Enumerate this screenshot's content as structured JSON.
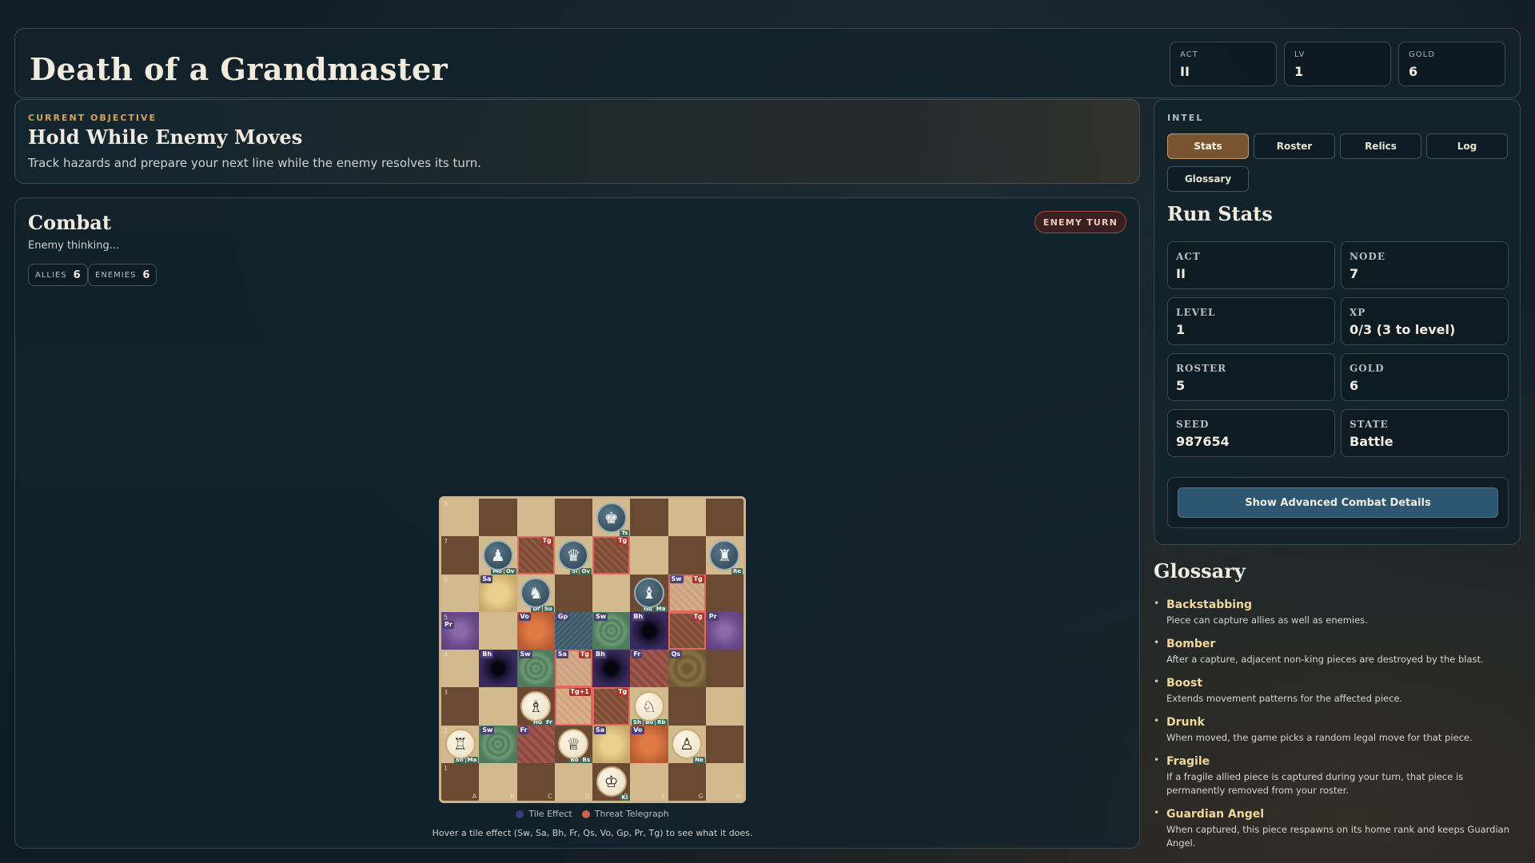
{
  "header": {
    "title": "Death of a Grandmaster",
    "stats": [
      {
        "label": "ACT",
        "value": "II"
      },
      {
        "label": "LV",
        "value": "1"
      },
      {
        "label": "GOLD",
        "value": "6"
      }
    ]
  },
  "objective": {
    "kicker": "CURRENT OBJECTIVE",
    "title": "Hold While Enemy Moves",
    "description": "Track hazards and prepare your next line while the enemy resolves its turn."
  },
  "combat": {
    "title": "Combat",
    "status": "Enemy thinking...",
    "badge": "ENEMY TURN",
    "allies_label": "ALLIES",
    "allies_count": "6",
    "enemies_label": "ENEMIES",
    "enemies_count": "6",
    "legend_tile": "Tile Effect",
    "legend_threat": "Threat Telegraph",
    "legend_tile_color": "#3b3b78",
    "legend_threat_color": "#c8614f",
    "hint": "Hover a tile effect (Sw, Sa, Bh, Fr, Qs, Vo, Gp, Pr, Tg) to see what it does.",
    "files": [
      "A",
      "B",
      "C",
      "D",
      "E",
      "F",
      "G",
      "H"
    ],
    "ranks": [
      "8",
      "7",
      "6",
      "5",
      "4",
      "3",
      "2",
      "1"
    ]
  },
  "board": {
    "a8": {
      "tile": null
    },
    "b8": {},
    "c8": {},
    "d8": {},
    "e8": {
      "piece": "king",
      "side": "enemy",
      "mods": [
        "Ts"
      ]
    },
    "b7": {
      "piece": "pawn",
      "side": "enemy",
      "mods": [
        "Mo",
        "Ov"
      ]
    },
    "c7": {
      "threat": "Tg"
    },
    "d7": {
      "piece": "queen",
      "side": "enemy",
      "mods": [
        "Sl",
        "Ov"
      ]
    },
    "e7": {
      "threat": "Tg"
    },
    "h7": {
      "piece": "rook",
      "side": "enemy",
      "mods": [
        "Re"
      ]
    },
    "b6": {
      "tile": "Sa"
    },
    "c6": {
      "piece": "knight",
      "side": "enemy",
      "mods": [
        "Dr",
        "Su"
      ]
    },
    "f6": {
      "piece": "bishop",
      "side": "enemy",
      "mods": [
        "Gu",
        "Ma"
      ]
    },
    "g6": {
      "tile": "Sw",
      "threat": "Tg"
    },
    "a5": {
      "tile": "Pr"
    },
    "c5": {
      "tile": "Vo"
    },
    "d5": {
      "tile": "Gp"
    },
    "e5": {
      "tile": "Sw"
    },
    "f5": {
      "tile": "Bh"
    },
    "g5": {
      "threat": "Tg"
    },
    "h5": {
      "tile": "Pr"
    },
    "b4": {
      "tile": "Bh"
    },
    "c4": {
      "tile": "Sw"
    },
    "d4": {
      "tile": "Sa",
      "threat": "Tg"
    },
    "e4": {
      "tile": "Bh"
    },
    "f4": {
      "tile": "Fr"
    },
    "g4": {
      "tile": "Qs"
    },
    "c3": {
      "piece": "bishop",
      "side": "ally",
      "mods": [
        "Hu",
        "Fr"
      ]
    },
    "d3": {
      "threat": "Tg+1"
    },
    "e3": {
      "threat": "Tg"
    },
    "f3": {
      "piece": "knight",
      "side": "ally",
      "mods": [
        "Sh",
        "Bo",
        "Rb"
      ]
    },
    "a2": {
      "piece": "rook",
      "side": "ally",
      "mods": [
        "Sh",
        "Ma"
      ]
    },
    "b2": {
      "tile": "Sw"
    },
    "c2": {
      "tile": "Fr"
    },
    "d2": {
      "piece": "queen",
      "side": "ally",
      "mods": [
        "Bo",
        "Bs"
      ]
    },
    "e2": {
      "tile": "Sa"
    },
    "f2": {
      "tile": "Vo"
    },
    "g2": {
      "piece": "pawn",
      "side": "ally",
      "mods": [
        "Ne"
      ]
    },
    "e1": {
      "piece": "king",
      "side": "ally",
      "mods": [
        "Ki"
      ]
    }
  },
  "intel": {
    "kicker": "INTEL",
    "tabs": [
      "Stats",
      "Roster",
      "Relics",
      "Log",
      "Glossary"
    ],
    "active_tab": "Stats",
    "title": "Run Stats",
    "stats": [
      {
        "label": "ACT",
        "value": "II"
      },
      {
        "label": "NODE",
        "value": "7"
      },
      {
        "label": "LEVEL",
        "value": "1"
      },
      {
        "label": "XP",
        "value": "0/3 (3 to level)"
      },
      {
        "label": "ROSTER",
        "value": "5"
      },
      {
        "label": "GOLD",
        "value": "6"
      },
      {
        "label": "SEED",
        "value": "987654"
      },
      {
        "label": "STATE",
        "value": "Battle"
      }
    ],
    "advanced_button": "Show Advanced Combat Details"
  },
  "glossary": {
    "title": "Glossary",
    "items": [
      {
        "term": "Backstabbing",
        "definition": "Piece can capture allies as well as enemies."
      },
      {
        "term": "Bomber",
        "definition": "After a capture, adjacent non-king pieces are destroyed by the blast."
      },
      {
        "term": "Boost",
        "definition": "Extends movement patterns for the affected piece."
      },
      {
        "term": "Drunk",
        "definition": "When moved, the game picks a random legal move for that piece."
      },
      {
        "term": "Fragile",
        "definition": "If a fragile allied piece is captured during your turn, that piece is permanently removed from your roster."
      },
      {
        "term": "Guardian Angel",
        "definition": "When captured, this piece respawns on its home rank and keeps Guardian Angel."
      }
    ]
  }
}
